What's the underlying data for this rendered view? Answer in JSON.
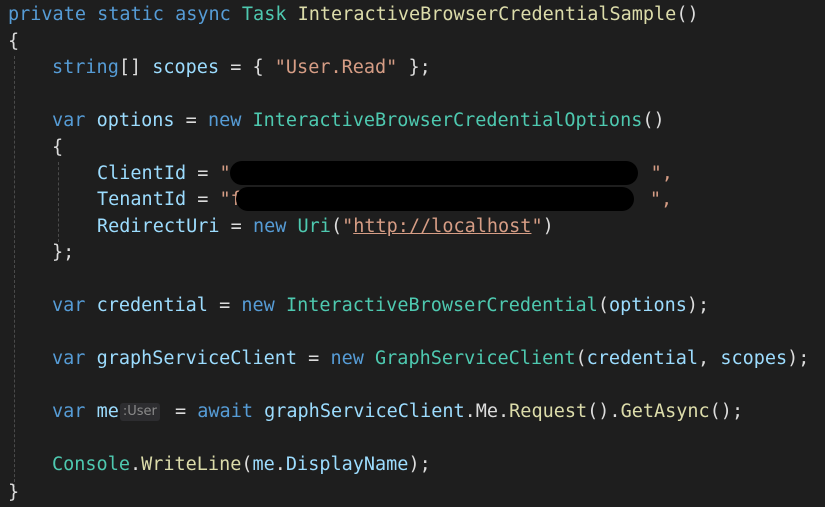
{
  "code": {
    "signature": {
      "kw_private": "private",
      "kw_static": "static",
      "kw_async": "async",
      "type_task": "Task",
      "method_name": "InteractiveBrowserCredentialSample",
      "parens": "()"
    },
    "open_brace": "{",
    "close_brace": "}",
    "scopes_line": {
      "type": "string",
      "brackets": "[]",
      "name": "scopes",
      "assign": " = { ",
      "value": "\"User.Read\"",
      "end": " };"
    },
    "options_line": {
      "kw_var": "var",
      "name": "options",
      "assign": " = ",
      "kw_new": "new",
      "type": "InteractiveBrowserCredentialOptions",
      "parens": "()"
    },
    "init_open": "{",
    "init_close": "};",
    "client_id_line": {
      "prop": "ClientId",
      "assign": " = ",
      "value_start": "\"",
      "value_end": "\","
    },
    "tenant_id_line": {
      "prop": "TenantId",
      "assign": " = ",
      "value_start": "\"f",
      "value_end": "\","
    },
    "redirect_line": {
      "prop": "RedirectUri",
      "assign": " = ",
      "kw_new": "new",
      "type": "Uri",
      "open": "(",
      "quote_open": "\"",
      "url": "http://localhost",
      "quote_close": "\"",
      "close": ")"
    },
    "credential_line": {
      "kw_var": "var",
      "name": "credential",
      "assign": " = ",
      "kw_new": "new",
      "type": "InteractiveBrowserCredential",
      "open": "(",
      "arg": "options",
      "close": ");"
    },
    "graph_line": {
      "kw_var": "var",
      "name": "graphServiceClient",
      "assign": " = ",
      "kw_new": "new",
      "type": "GraphServiceClient",
      "open": "(",
      "arg1": "credential",
      "sep": ", ",
      "arg2": "scopes",
      "close": ");"
    },
    "me_line": {
      "kw_var": "var",
      "name": "me",
      "type_hint": ":User",
      "assign": " = ",
      "kw_await": "await",
      "obj": "graphServiceClient",
      "dot1": ".",
      "prop": "Me",
      "dot2": ".",
      "method1": "Request",
      "call1": "()",
      "dot3": ".",
      "method2": "GetAsync",
      "call2": "();"
    },
    "console_line": {
      "type": "Console",
      "dot1": ".",
      "method": "WriteLine",
      "open": "(",
      "obj": "me",
      "dot2": ".",
      "prop": "DisplayName",
      "close": ");"
    }
  }
}
